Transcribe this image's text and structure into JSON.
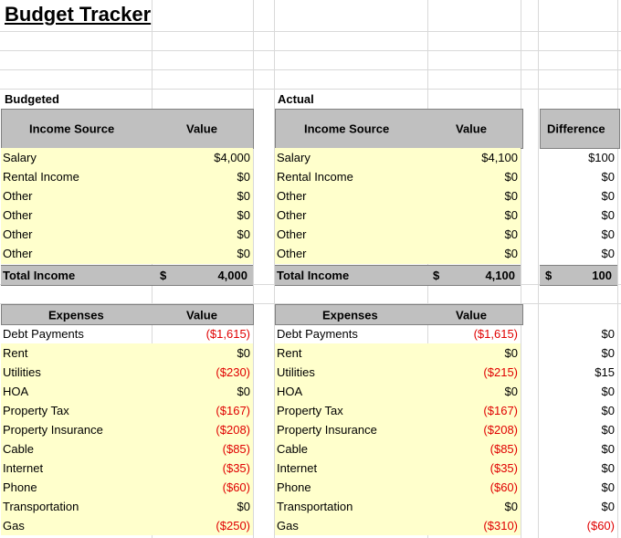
{
  "title": "Budget Tracker",
  "budgeted": {
    "section_label": "Budgeted",
    "income_header": {
      "source": "Income Source",
      "value": "Value"
    },
    "income": [
      {
        "label": "Salary",
        "value": "$4,000"
      },
      {
        "label": "Rental Income",
        "value": "$0"
      },
      {
        "label": "Other",
        "value": "$0"
      },
      {
        "label": "Other",
        "value": "$0"
      },
      {
        "label": "Other",
        "value": "$0"
      },
      {
        "label": "Other",
        "value": "$0"
      }
    ],
    "total": {
      "label": "Total Income",
      "currency": "$",
      "amount": "4,000"
    },
    "expense_header": {
      "source": "Expenses",
      "value": "Value"
    },
    "expenses": [
      {
        "label": "Debt Payments",
        "value": "($1,615)"
      },
      {
        "label": "Rent",
        "value": "$0"
      },
      {
        "label": "Utilities",
        "value": "($230)"
      },
      {
        "label": "HOA",
        "value": "$0"
      },
      {
        "label": "Property Tax",
        "value": "($167)"
      },
      {
        "label": "Property Insurance",
        "value": "($208)"
      },
      {
        "label": "Cable",
        "value": "($85)"
      },
      {
        "label": "Internet",
        "value": "($35)"
      },
      {
        "label": "Phone",
        "value": "($60)"
      },
      {
        "label": "Transportation",
        "value": "$0"
      },
      {
        "label": "Gas",
        "value": "($250)"
      }
    ]
  },
  "actual": {
    "section_label": "Actual",
    "income_header": {
      "source": "Income Source",
      "value": "Value"
    },
    "income": [
      {
        "label": "Salary",
        "value": "$4,100"
      },
      {
        "label": "Rental Income",
        "value": "$0"
      },
      {
        "label": "Other",
        "value": "$0"
      },
      {
        "label": "Other",
        "value": "$0"
      },
      {
        "label": "Other",
        "value": "$0"
      },
      {
        "label": "Other",
        "value": "$0"
      }
    ],
    "total": {
      "label": "Total Income",
      "currency": "$",
      "amount": "4,100"
    },
    "expense_header": {
      "source": "Expenses",
      "value": "Value"
    },
    "expenses": [
      {
        "label": "Debt Payments",
        "value": "($1,615)"
      },
      {
        "label": "Rent",
        "value": "$0"
      },
      {
        "label": "Utilities",
        "value": "($215)"
      },
      {
        "label": "HOA",
        "value": "$0"
      },
      {
        "label": "Property Tax",
        "value": "($167)"
      },
      {
        "label": "Property Insurance",
        "value": "($208)"
      },
      {
        "label": "Cable",
        "value": "($85)"
      },
      {
        "label": "Internet",
        "value": "($35)"
      },
      {
        "label": "Phone",
        "value": "($60)"
      },
      {
        "label": "Transportation",
        "value": "$0"
      },
      {
        "label": "Gas",
        "value": "($310)"
      }
    ]
  },
  "difference": {
    "header": "Difference",
    "income": [
      "$100",
      "$0",
      "$0",
      "$0",
      "$0",
      "$0"
    ],
    "total": {
      "currency": "$",
      "amount": "100"
    },
    "expenses": [
      "$0",
      "$0",
      "$15",
      "$0",
      "$0",
      "$0",
      "$0",
      "$0",
      "$0",
      "$0",
      "($60)"
    ]
  },
  "colors": {
    "header_fill": "#c0c0c0",
    "input_fill": "#ffffcc",
    "negative": "#e00000"
  }
}
